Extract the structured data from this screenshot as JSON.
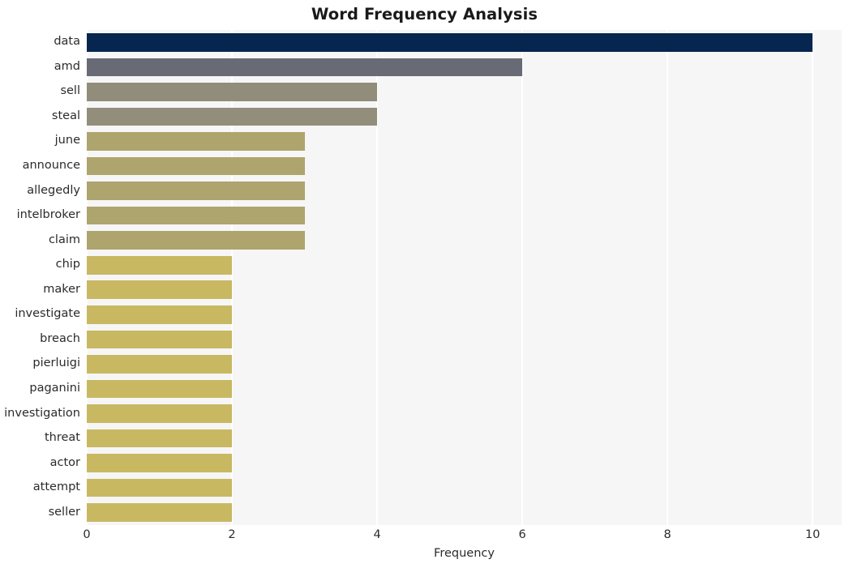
{
  "chart_data": {
    "type": "bar",
    "orientation": "horizontal",
    "title": "Word Frequency Analysis",
    "xlabel": "Frequency",
    "ylabel": "",
    "xlim": [
      0,
      10.4
    ],
    "xticks": [
      0,
      2,
      4,
      6,
      8,
      10
    ],
    "xtick_labels": [
      "0",
      "2",
      "4",
      "6",
      "8",
      "10"
    ],
    "grid": true,
    "grid_color": "#ffffff",
    "plot_background": "#f6f6f7",
    "figure_background": "#ffffff",
    "legend": null,
    "categories": [
      "data",
      "amd",
      "sell",
      "steal",
      "june",
      "announce",
      "allegedly",
      "intelbroker",
      "claim",
      "chip",
      "maker",
      "investigate",
      "breach",
      "pierluigi",
      "paganini",
      "investigation",
      "threat",
      "actor",
      "attempt",
      "seller"
    ],
    "values": [
      10,
      6,
      4,
      4,
      3,
      3,
      3,
      3,
      3,
      2,
      2,
      2,
      2,
      2,
      2,
      2,
      2,
      2,
      2,
      2
    ],
    "bar_colors": [
      "#06264f",
      "#686b75",
      "#928d7a",
      "#938e7b",
      "#aea46e",
      "#aea46e",
      "#aea46e",
      "#aea46e",
      "#aea46e",
      "#c9b862",
      "#c9b862",
      "#c9b862",
      "#c9b862",
      "#c9b862",
      "#c9b862",
      "#c9b862",
      "#c9b862",
      "#c9b862",
      "#c9b862",
      "#c9b862"
    ]
  }
}
